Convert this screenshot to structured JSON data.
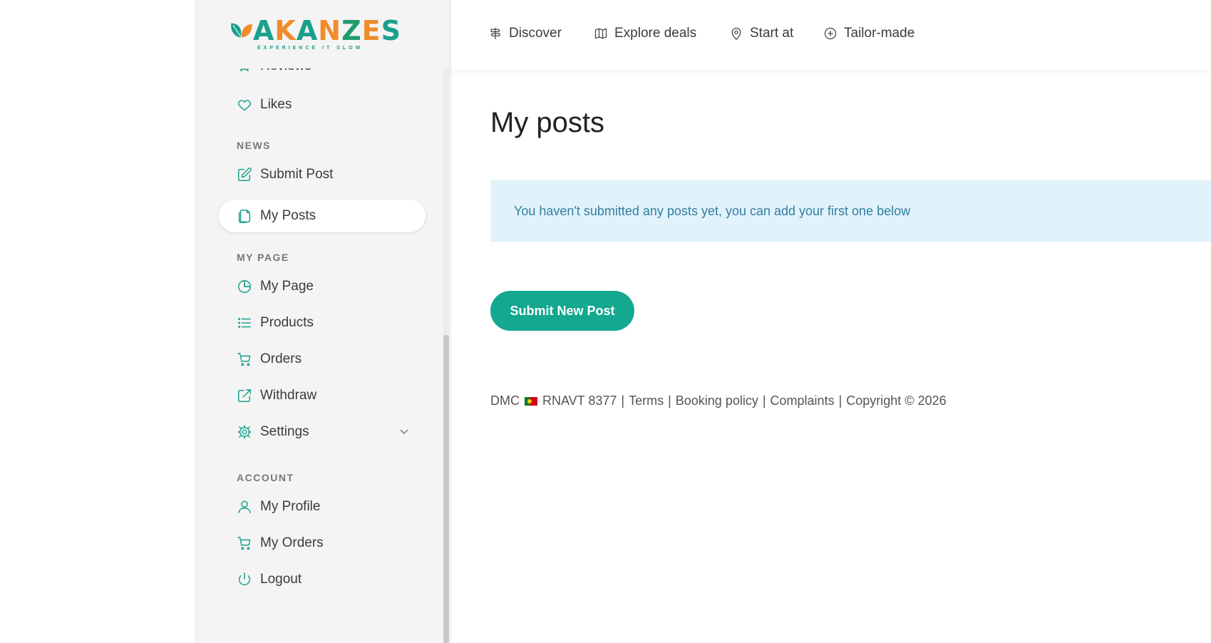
{
  "logo": {
    "word": "AKANZES",
    "tagline": "EXPERIENCE IT SLOW",
    "brand_colors": [
      "#1aa08c",
      "#f28b2b",
      "#1e9c6e"
    ]
  },
  "topnav": {
    "items": [
      {
        "label": "Discover",
        "icon": "signpost-icon"
      },
      {
        "label": "Explore deals",
        "icon": "map-icon"
      },
      {
        "label": "Start at",
        "icon": "map-pin-icon"
      },
      {
        "label": "Tailor-made",
        "icon": "plus-circle-icon"
      }
    ]
  },
  "sidebar": {
    "partial_item": {
      "label": "Reviews",
      "icon": "star-icon"
    },
    "likes": {
      "label": "Likes",
      "icon": "heart-icon"
    },
    "sections": {
      "news": "NEWS",
      "my_page": "MY PAGE",
      "account": "ACCOUNT"
    },
    "news_items": [
      {
        "label": "Submit Post",
        "icon": "edit-icon"
      },
      {
        "label": "My Posts",
        "icon": "documents-icon",
        "active": true
      }
    ],
    "my_page_items": [
      {
        "label": "My Page",
        "icon": "pie-chart-icon"
      },
      {
        "label": "Products",
        "icon": "list-icon"
      },
      {
        "label": "Orders",
        "icon": "cart-icon"
      },
      {
        "label": "Withdraw",
        "icon": "share-out-icon"
      },
      {
        "label": "Settings",
        "icon": "gear-icon",
        "expandable": true
      }
    ],
    "account_items": [
      {
        "label": "My Profile",
        "icon": "user-icon"
      },
      {
        "label": "My Orders",
        "icon": "cart-icon"
      },
      {
        "label": "Logout",
        "icon": "power-icon"
      }
    ]
  },
  "main": {
    "title": "My posts",
    "notice": "You haven't submitted any posts yet, you can add your first one below",
    "submit_button": "Submit New Post"
  },
  "footer": {
    "dmc": "DMC",
    "rnavt": "RNAVT 8377",
    "links": [
      "Terms",
      "Booking policy",
      "Complaints"
    ],
    "copyright": "Copyright © 2026"
  },
  "colors": {
    "accent": "#13a88f",
    "notice_bg": "#e2f2fa",
    "notice_text": "#2f7fa3",
    "sidebar_bg": "#f4f4f4"
  }
}
